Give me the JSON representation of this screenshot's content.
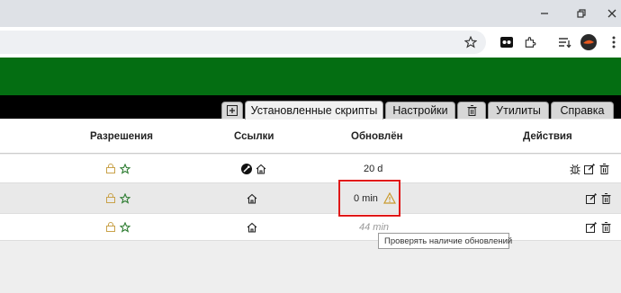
{
  "browser": {
    "window_controls": [
      "minimize",
      "restore",
      "close"
    ],
    "toolbar_icons": [
      "star-icon",
      "extension-icon",
      "puzzle-icon",
      "reading-list-icon",
      "profile-avatar",
      "menu-icon"
    ]
  },
  "colors": {
    "header_green": "#046e12",
    "highlight_red": "#e01818",
    "lock_gold": "#c9a24a",
    "star_green": "#2e7d32"
  },
  "tabs": [
    {
      "label": "",
      "icon": "plus-square-icon"
    },
    {
      "label": "Установленные скрипты",
      "active": true
    },
    {
      "label": "Настройки"
    },
    {
      "label": "",
      "icon": "trash-icon"
    },
    {
      "label": "Утилиты"
    },
    {
      "label": "Справка"
    }
  ],
  "table": {
    "headers": {
      "permissions": "Разрешения",
      "links": "Ссылки",
      "updated": "Обновлён",
      "actions": "Действия"
    },
    "rows": [
      {
        "updated": "20 d",
        "links": [
          "wrench-icon",
          "home-icon"
        ],
        "actions": [
          "bug-icon",
          "edit-icon",
          "delete-icon"
        ]
      },
      {
        "updated": "0 min",
        "links": [
          "home-icon"
        ],
        "actions": [
          "edit-icon",
          "delete-icon"
        ],
        "warning": true
      },
      {
        "updated": "44 min",
        "links": [
          "home-icon"
        ],
        "actions": [
          "edit-icon",
          "delete-icon"
        ],
        "dim": true
      }
    ]
  },
  "tooltip": "Проверять наличие обновлений"
}
